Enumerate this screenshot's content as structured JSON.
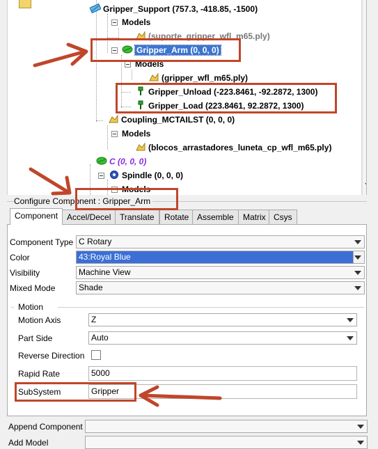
{
  "tree": {
    "nodes": [
      {
        "label": "Gripper_Support (757.3, -418.85, -1500)"
      },
      {
        "label": "Models"
      },
      {
        "label": "(suporte_gripper_wfl_m65.ply)"
      },
      {
        "label": "Gripper_Arm (0, 0, 0)"
      },
      {
        "label": "Models"
      },
      {
        "label": "(gripper_wfl_m65.ply)"
      },
      {
        "label": "Gripper_Unload (-223.8461, -92.2872, 1300)"
      },
      {
        "label": "Gripper_Load (223.8461, 92.2872, 1300)"
      },
      {
        "label": "Coupling_MCTAILST (0, 0, 0)"
      },
      {
        "label": "Models"
      },
      {
        "label": "(blocos_arrastadores_luneta_cp_wfl_m65.ply)"
      },
      {
        "label": "C (0, 0, 0)"
      },
      {
        "label": "Spindle (0, 0, 0)"
      },
      {
        "label": "Models"
      }
    ]
  },
  "configure": {
    "title": "Configure Component : Gripper_Arm"
  },
  "tabs": [
    "Component",
    "Accel/Decel",
    "Translate",
    "Rotate",
    "Assemble",
    "Matrix",
    "Csys"
  ],
  "fields": {
    "component_type": {
      "label": "Component Type",
      "value": "C Rotary"
    },
    "color": {
      "label": "Color",
      "value": "43:Royal Blue",
      "swatch": "#3b6fd6"
    },
    "visibility": {
      "label": "Visibility",
      "value": "Machine View"
    },
    "mixed_mode": {
      "label": "Mixed Mode",
      "value": "Shade"
    }
  },
  "motion": {
    "group_label": "Motion",
    "motion_axis": {
      "label": "Motion Axis",
      "value": "Z"
    },
    "part_side": {
      "label": "Part Side",
      "value": "Auto"
    },
    "reverse_direction": {
      "label": "Reverse Direction",
      "checked": false
    },
    "rapid_rate": {
      "label": "Rapid Rate",
      "value": "5000"
    },
    "subsystem": {
      "label": "SubSystem",
      "value": "Gripper"
    }
  },
  "bottom": {
    "append_component": {
      "label": "Append Component",
      "value": ""
    },
    "add_model": {
      "label": "Add Model",
      "value": ""
    }
  },
  "colors": {
    "annotation": "#c0462a",
    "selection": "#3b75d0",
    "c_node": "#8a2be2"
  },
  "icons": {
    "folder": "folder-icon",
    "gear": "gear-icon",
    "model": "model-icon",
    "pin": "pin-icon",
    "axis": "rotary-axis-icon",
    "spindle": "spindle-icon"
  }
}
